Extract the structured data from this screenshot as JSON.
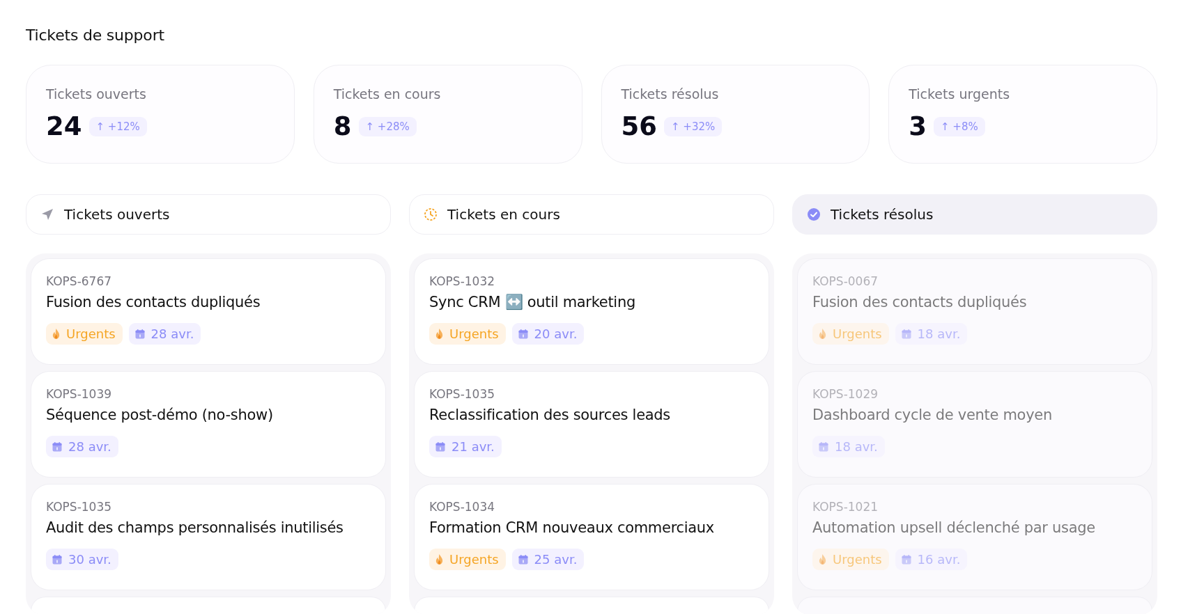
{
  "page_title": "Tickets de support",
  "stats": [
    {
      "label": "Tickets ouverts",
      "value": "24",
      "change": "↑ +12%"
    },
    {
      "label": "Tickets en cours",
      "value": "8",
      "change": "↑ +28%"
    },
    {
      "label": "Tickets résolus",
      "value": "56",
      "change": "↑ +32%"
    },
    {
      "label": "Tickets urgents",
      "value": "3",
      "change": "↑ +8%"
    }
  ],
  "columns": [
    {
      "kind": "open",
      "title": "Tickets ouverts",
      "dimmed": false,
      "more_below": true,
      "cards": [
        {
          "id": "KOPS-6767",
          "title": "Fusion des contacts dupliqués",
          "tags": [
            {
              "kind": "urgent",
              "label": "Urgents"
            },
            {
              "kind": "date",
              "label": "28 avr."
            }
          ]
        },
        {
          "id": "KOPS-1039",
          "title": "Séquence post-démo (no-show)",
          "tags": [
            {
              "kind": "date",
              "label": "28 avr."
            }
          ]
        },
        {
          "id": "KOPS-1035",
          "title": "Audit des champs personnalisés inutilisés",
          "tags": [
            {
              "kind": "date",
              "label": "30 avr."
            }
          ]
        }
      ]
    },
    {
      "kind": "progress",
      "title": "Tickets en cours",
      "dimmed": false,
      "more_below": true,
      "cards": [
        {
          "id": "KOPS-1032",
          "title": "Sync CRM ↔️ outil marketing",
          "tags": [
            {
              "kind": "urgent",
              "label": "Urgents"
            },
            {
              "kind": "date",
              "label": "20 avr."
            }
          ]
        },
        {
          "id": "KOPS-1035",
          "title": "Reclassification des sources leads",
          "tags": [
            {
              "kind": "date",
              "label": "21 avr."
            }
          ]
        },
        {
          "id": "KOPS-1034",
          "title": "Formation CRM nouveaux commerciaux",
          "tags": [
            {
              "kind": "urgent",
              "label": "Urgents"
            },
            {
              "kind": "date",
              "label": "25 avr."
            }
          ]
        }
      ]
    },
    {
      "kind": "resolved",
      "title": "Tickets résolus",
      "dimmed": true,
      "more_below": true,
      "cards": [
        {
          "id": "KOPS-0067",
          "title": "Fusion des contacts dupliqués",
          "tags": [
            {
              "kind": "urgent",
              "label": "Urgents"
            },
            {
              "kind": "date",
              "label": "18 avr."
            }
          ]
        },
        {
          "id": "KOPS-1029",
          "title": "Dashboard cycle de vente moyen",
          "tags": [
            {
              "kind": "date",
              "label": "18 avr."
            }
          ]
        },
        {
          "id": "KOPS-1021",
          "title": "Automation upsell déclenché par usage",
          "tags": [
            {
              "kind": "urgent",
              "label": "Urgents"
            },
            {
              "kind": "date",
              "label": "16 avr."
            }
          ]
        }
      ]
    }
  ]
}
